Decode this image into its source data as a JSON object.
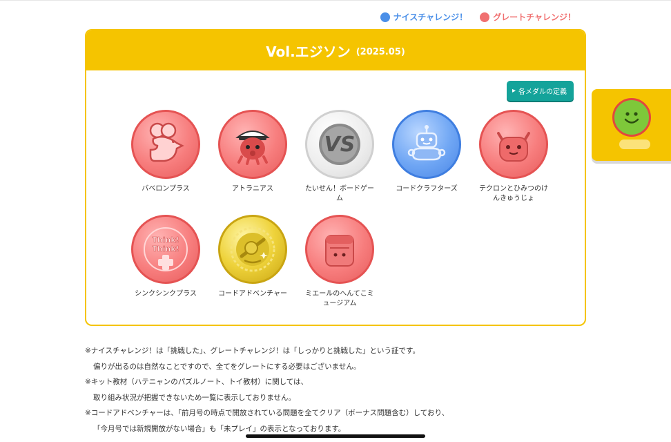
{
  "legend": {
    "nice_label": "ナイスチャレンジ！",
    "nice_color": "#4a8fe8",
    "great_label": "グレートチャレンジ！",
    "great_color": "#f07070"
  },
  "card": {
    "title": "Vol.エジソン",
    "subtitle": "(2025.05)",
    "definition_button": "各メダルの定義"
  },
  "medals": [
    {
      "label": "バベロンプラス",
      "status": "great",
      "icon": "mouse-icon"
    },
    {
      "label": "アトラニアス",
      "status": "great",
      "icon": "octopus-captain-icon"
    },
    {
      "label": "たいせん！ボードゲーム",
      "status": "none",
      "icon": "vs-icon"
    },
    {
      "label": "コードクラフターズ",
      "status": "nice",
      "icon": "robot-icon"
    },
    {
      "label": "テクロンとひみつのけんきゅうじょ",
      "status": "great",
      "icon": "monster-icon"
    },
    {
      "label": "シンクシンクプラス",
      "status": "great",
      "icon": "think-think-icon",
      "badge_text": "Think! Think!"
    },
    {
      "label": "コードアドベンチャー",
      "status": "gold",
      "icon": "explorer-icon"
    },
    {
      "label": "ミエールのへんてこミュージアム",
      "status": "great",
      "icon": "box-character-icon"
    }
  ],
  "notes": [
    "※ナイスチャレンジ！は「挑戦した」、グレートチャレンジ！は「しっかりと挑戦した」という証です。",
    "偏りが出るのは自然なことですので、全てをグレートにする必要はございません。",
    "※キット教材（ハテニャンのパズルノート、トイ教材）に関しては、",
    "取り組み状況が把握できないため一覧に表示しておりません。",
    "※コードアドベンチャーは、「前月号の時点で開放されている問題を全てクリア（ボーナス問題含む）しており、",
    "「今月号では新規開放がない場合」も「未プレイ」の表示となっております。"
  ],
  "side_panel": {
    "icon": "smile-icon",
    "color": "#7ec83a"
  }
}
